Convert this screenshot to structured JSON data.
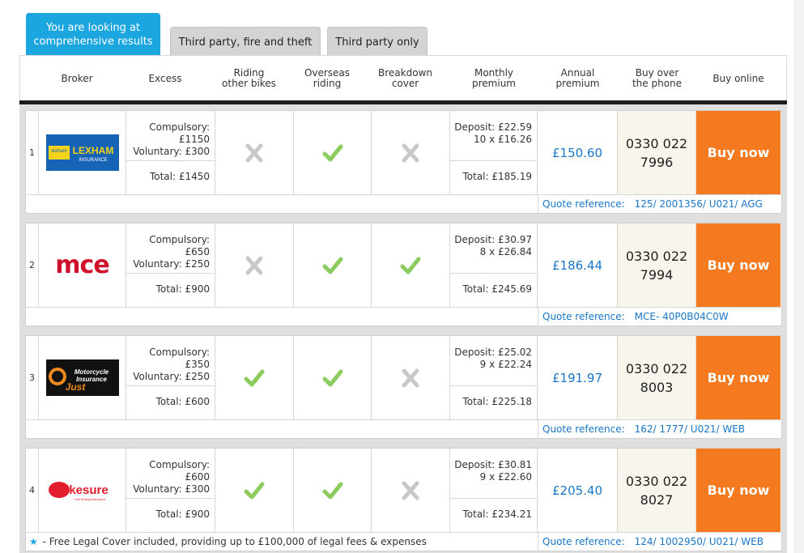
{
  "tabs": [
    {
      "label": "You are looking at comprehensive results",
      "active": true
    },
    {
      "label": "Third party, fire and theft",
      "active": false
    },
    {
      "label": "Third party only",
      "active": false
    }
  ],
  "columns": [
    "Broker",
    "Excess",
    "Riding\nother bikes",
    "Overseas\nriding",
    "Breakdown\ncover",
    "Monthly\npremium",
    "Annual\npremium",
    "Buy over\nthe phone",
    "Buy online"
  ],
  "results": [
    {
      "rank": "1",
      "broker": "Lexham Insurance",
      "logo_text": "LEXHAM",
      "logo_sub": "INSURANCE",
      "logo_badge": "lexham",
      "compulsory": "Compulsory: £1150",
      "voluntary": "Voluntary: £300",
      "excess_total": "Total: £1450",
      "riding_other_bikes": false,
      "overseas_riding": true,
      "breakdown_cover": false,
      "deposit": "Deposit: £22.59",
      "instalments": "10 x £16.26",
      "monthly_total": "Total: £185.19",
      "annual": "£150.60",
      "phone_line1": "0330 022",
      "phone_line2": "7996",
      "buy_label": "Buy now",
      "quote_label": "Quote reference:",
      "quote_ref": "125/ 2001356/ U021/ AGG"
    },
    {
      "rank": "2",
      "broker": "MCE",
      "logo_text": "mce",
      "compulsory": "Compulsory: £650",
      "voluntary": "Voluntary: £250",
      "excess_total": "Total: £900",
      "riding_other_bikes": false,
      "overseas_riding": true,
      "breakdown_cover": true,
      "deposit": "Deposit: £30.97",
      "instalments": "8 x £26.84",
      "monthly_total": "Total: £245.69",
      "annual": "£186.44",
      "phone_line1": "0330 022",
      "phone_line2": "7994",
      "buy_label": "Buy now",
      "quote_label": "Quote reference:",
      "quote_ref": "MCE- 40P0B04C0W"
    },
    {
      "rank": "3",
      "broker": "Just Motorcycle Insurance",
      "logo_text": "Motorcycle",
      "logo_sub": "Insurance",
      "logo_badge": "Just",
      "compulsory": "Compulsory: £350",
      "voluntary": "Voluntary: £250",
      "excess_total": "Total: £600",
      "riding_other_bikes": true,
      "overseas_riding": true,
      "breakdown_cover": false,
      "deposit": "Deposit: £25.02",
      "instalments": "9 x £22.24",
      "monthly_total": "Total: £225.18",
      "annual": "£191.97",
      "phone_line1": "0330 022",
      "phone_line2": "8003",
      "buy_label": "Buy now",
      "quote_label": "Quote reference:",
      "quote_ref": "162/ 1777/ U021/ WEB"
    },
    {
      "rank": "4",
      "broker": "Bikesure",
      "logo_text": "Bikesure",
      "logo_sub": "Fast finding insurance",
      "compulsory": "Compulsory: £600",
      "voluntary": "Voluntary: £300",
      "excess_total": "Total: £900",
      "riding_other_bikes": true,
      "overseas_riding": true,
      "breakdown_cover": false,
      "deposit": "Deposit: £30.81",
      "instalments": "9 x £22.60",
      "monthly_total": "Total: £234.21",
      "annual": "£205.40",
      "phone_line1": "0330 022",
      "phone_line2": "8027",
      "buy_label": "Buy now",
      "quote_label": "Quote reference:",
      "quote_ref": "124/ 1002950/ U021/ WEB",
      "note": "- Free Legal Cover included, providing up to £100,000 of legal fees & expenses"
    }
  ],
  "colors": {
    "accent": "#1ba6e0",
    "buy": "#f5791f",
    "price": "#1976c9",
    "tick": "#8ccb5e",
    "cross": "#c8c8c8"
  }
}
